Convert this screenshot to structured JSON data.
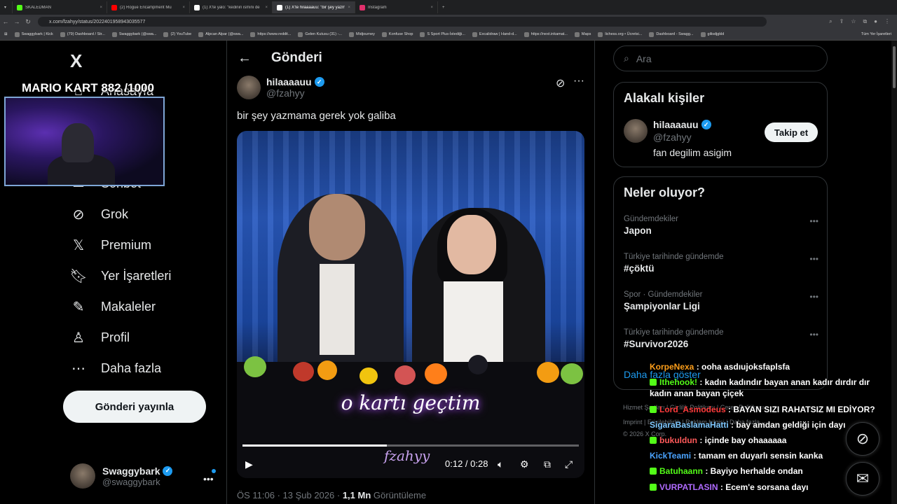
{
  "browser": {
    "tabs": [
      {
        "title": "SKALEDMAN",
        "color": "#53fc18"
      },
      {
        "title": "(2) Rogue Encampment Mu",
        "color": "#ff0000"
      },
      {
        "title": "(1) X'te yalo: \"kedinin ismini de",
        "color": "#ffffff"
      },
      {
        "title": "(1) X'te hilaaaauu: \"bir şey yazm",
        "color": "#ffffff"
      },
      {
        "title": "Instagram",
        "color": "#e1306c"
      }
    ],
    "url": "x.com/fzahyy/status/2022401958943035577",
    "bookmarks": [
      "Swaggybark | Kick",
      "(79) Dashboard / Str...",
      "Swaggybark (@swa...",
      "(2) YouTube",
      "Alpcan Alpar (@swa...",
      "https://www.reddit...",
      "Gelen Kutusu (31) -...",
      "Midjourney",
      "Konfuse Shop",
      "S Sport Plus-İstediği...",
      "Excalidraw | Hand-d...",
      "https://next.inkamat...",
      "Maps",
      "lichess.org • Ücretsi...",
      "Dashboard - Swagg...",
      "gilisdjgkld"
    ],
    "bookmarks_right": "Tüm Yer İşaretleri"
  },
  "overlay": {
    "title": "MARIO KART  882 /1000"
  },
  "nav": {
    "logo": "X",
    "items": [
      {
        "label": "Anasayfa",
        "icon": "home-icon",
        "glyph": "⌂"
      },
      {
        "label": "Sohbet",
        "icon": "chat-icon",
        "glyph": "✉"
      },
      {
        "label": "Grok",
        "icon": "grok-icon",
        "glyph": "⊘"
      },
      {
        "label": "Premium",
        "icon": "x-premium-icon",
        "glyph": "𝕏"
      },
      {
        "label": "Yer İşaretleri",
        "icon": "bookmark-icon",
        "glyph": "🔖︎"
      },
      {
        "label": "Makaleler",
        "icon": "articles-icon",
        "glyph": "✎"
      },
      {
        "label": "Profil",
        "icon": "profile-icon",
        "glyph": "♙"
      },
      {
        "label": "Daha fazla",
        "icon": "more-circle-icon",
        "glyph": "⋯"
      }
    ],
    "post_button": "Gönderi yayınla",
    "account": {
      "name": "Swaggybark",
      "handle": "@swaggybark"
    }
  },
  "post": {
    "header": "Gönderi",
    "author_name": "hilaaaauu",
    "author_handle": "@fzahyy",
    "text": "bir şey yazmama gerek yok galiba",
    "video": {
      "caption": "o kartı geçtim",
      "watermark": "fzahyy",
      "time": "0:12 / 0:28",
      "progress": 0.43
    },
    "timestamp": "ÖS 11:06 · 13 Şub 2026 · ",
    "views_count": "1,1 Mn",
    "views_label": " Görüntüleme"
  },
  "sidebar": {
    "search_placeholder": "Ara",
    "related": {
      "title": "Alakalı kişiler",
      "name": "hilaaaauu",
      "handle": "@fzahyy",
      "bio": "fan degilim asigim",
      "follow": "Takip et"
    },
    "trends": {
      "title": "Neler oluyor?",
      "items": [
        {
          "context": "Gündemdekiler",
          "topic": "Japon"
        },
        {
          "context": "Türkiye tarihinde gündemde",
          "topic": "#çöktü"
        },
        {
          "context": "Spor · Gündemdekiler",
          "topic": "Şampiyonlar Ligi"
        },
        {
          "context": "Türkiye tarihinde gündemde",
          "topic": "#Survivor2026"
        }
      ],
      "show_more": "Daha fazla göster"
    },
    "footer": {
      "line1": "Hizmet Şartları  |  Gizlilik Politikası  |  Çerez Politikası",
      "line2": "Imprint  |  Erişilebilirlik  |  Reklam bilgisi  |  Daha fazla ···",
      "line3": "© 2026 X Corp."
    }
  },
  "chat": [
    {
      "user": "KorpeNexa",
      "color": "#ff9f1a",
      "badge": false,
      "msg": " : ooha asdıujoksfaplsfa"
    },
    {
      "user": "Ithehook!",
      "color": "#53fc18",
      "badge": true,
      "msg": " : kadın kadındır bayan anan kadır dırdır dır kadın anan bayan çiçek"
    },
    {
      "user": "Lord_Asmodeus",
      "color": "#ff3b3b",
      "badge": true,
      "msg": " : BAYAN SIZI RAHATSIZ MI EDİYOR?"
    },
    {
      "user": "SigaraBaslamaHatti",
      "color": "#7fc8ff",
      "badge": false,
      "msg": " : bay amdan geldiği için dayı"
    },
    {
      "user": "bukuldun",
      "color": "#ff5a5a",
      "badge": true,
      "msg": " : içinde bay ohaaaaaa"
    },
    {
      "user": "KickTeami",
      "color": "#4aa3ff",
      "badge": false,
      "msg": " : tamam en duyarlı sensin kanka"
    },
    {
      "user": "Batuhaann",
      "color": "#53fc18",
      "badge": true,
      "msg": " : Bayiyo herhalde ondan"
    },
    {
      "user": "VURPATLASIN",
      "color": "#b06bff",
      "badge": true,
      "msg": " : Ecem'e sorsana dayı"
    }
  ]
}
